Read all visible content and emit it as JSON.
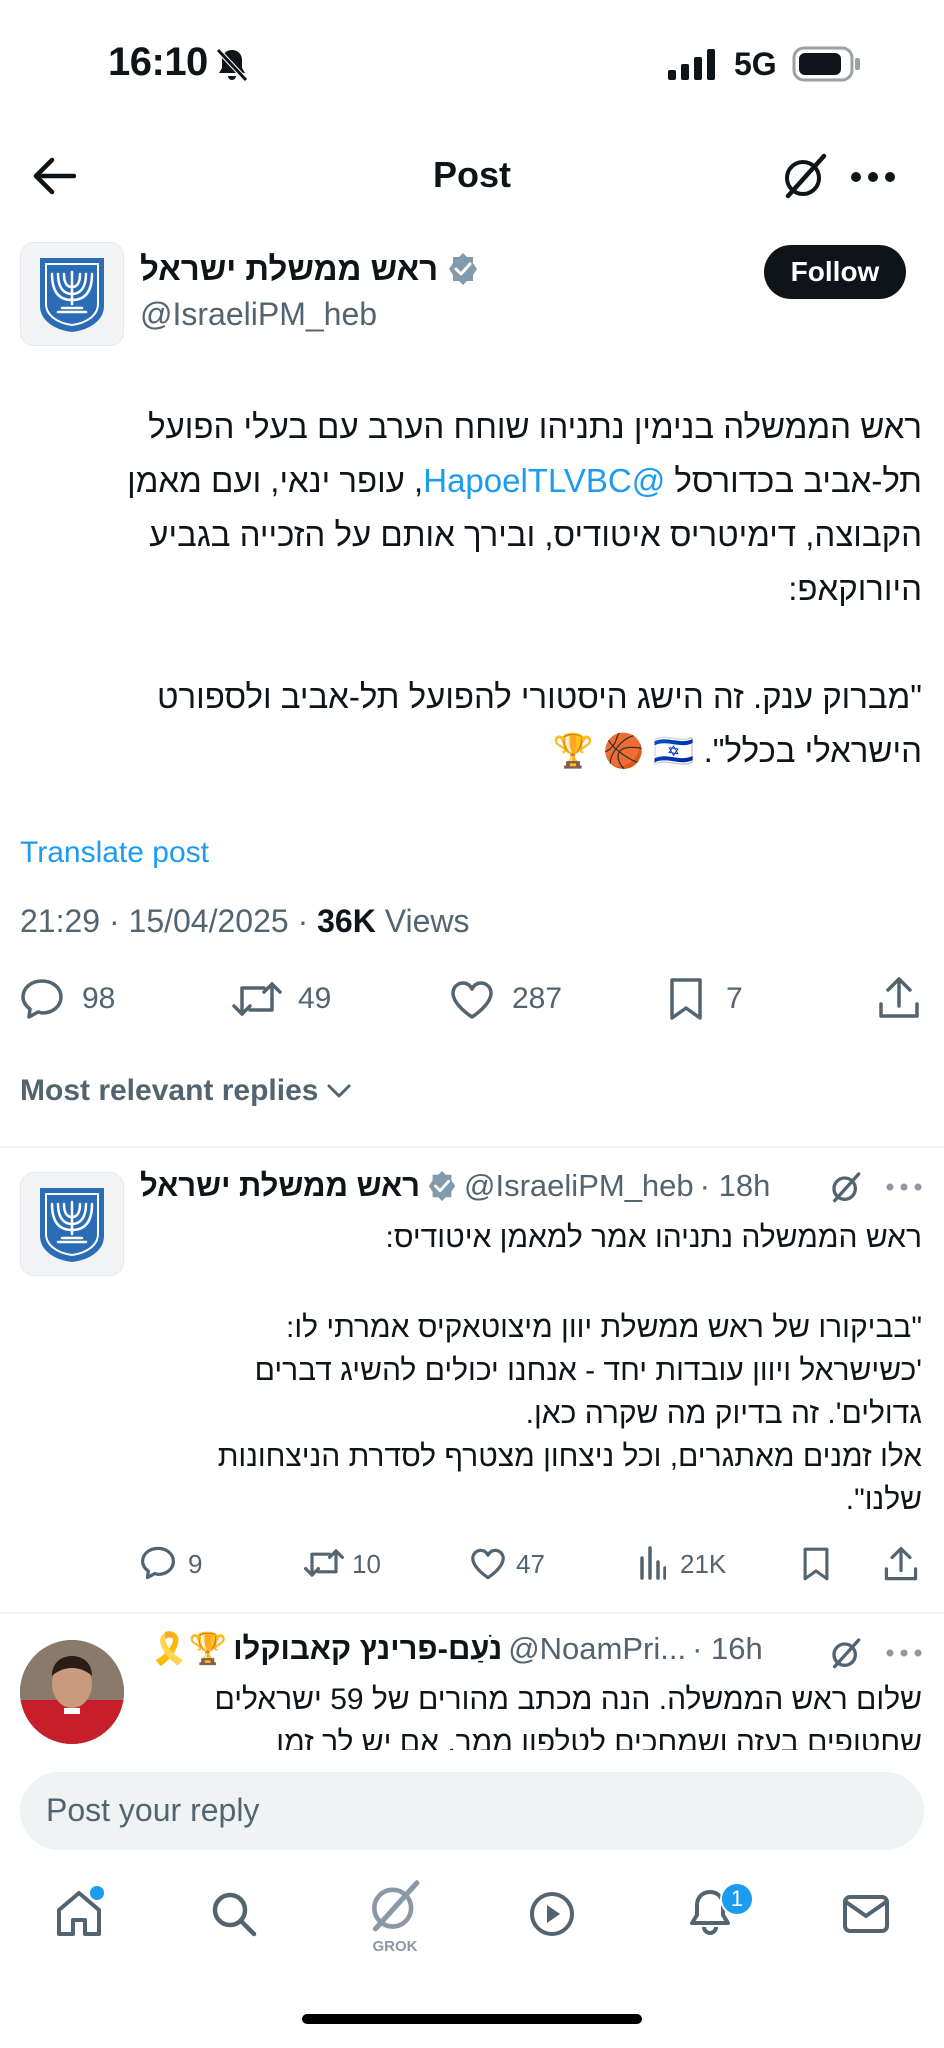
{
  "status_bar": {
    "time": "16:10",
    "network": "5G"
  },
  "header": {
    "title": "Post"
  },
  "post": {
    "author_name": "ראש ממשלת ישראל",
    "author_handle": "@IsraeliPM_heb",
    "follow_label": "Follow",
    "text_lines": [
      "ראש הממשלה בנימין נתניהו שוחח הערב עם בעלי הפועל",
      ", עופר ינאי, ועם מאמן",
      "הקבוצה, דימיטריס איטודיס, ובירך אותם על הזכייה בגביע",
      "היורוקאפ:",
      "\"מברוק ענק. זה הישג היסטורי להפועל תל-אביב ולספורט",
      "הישראלי בכלל\"."
    ],
    "line2_prefix": "תל-אביב בכדורסל",
    "mention": "@HapoelTLVBC",
    "emojis": "🇮🇱 🏀 🏆",
    "translate": "Translate post",
    "meta_time": "21:29 · 15/04/2025 · ",
    "meta_views_count": "36K",
    "meta_views_label": " Views",
    "replies": "98",
    "reposts": "49",
    "likes": "287",
    "bookmarks": "7"
  },
  "sort_label": "Most relevant replies",
  "replies": [
    {
      "name": "ראש ממשלת ישראל",
      "handle": "@IsraeliPM_heb",
      "time": "· 18h",
      "lines": [
        "ראש הממשלה נתניהו אמר למאמן איטודיס:",
        "\"בביקורו של ראש ממשלת יוון מיצוטאקיס אמרתי לו:",
        "'כשישראל ויוון עובדות יחד - אנחנו יכולים להשיג דברים",
        "גדולים'. זה בדיוק מה שקרה כאן.",
        "אלו זמנים מאתגרים, וכל ניצחון מצטרף לסדרת הניצחונות",
        "שלנו\"."
      ],
      "replies": "9",
      "reposts": "10",
      "likes": "47",
      "views": "21K"
    },
    {
      "name": "נֹעַם-פרינץ קאבוקלו",
      "badges": "🎗️🏆",
      "handle": "@NoamPri...",
      "time": "· 16h",
      "lines": [
        "שלום ראש הממשלה. הנה מכתב מהורים של 59 ישראלים",
        "שחטופים בעזה ושמחכים לטלפון ממך. אם יש לך זמן"
      ]
    }
  ],
  "reply_placeholder": "Post your reply",
  "nav": {
    "grok_label": "GROK",
    "notifications_badge": "1"
  },
  "colors": {
    "accent": "#1d9bf0",
    "text": "#0f1419",
    "secondary": "#536471"
  }
}
